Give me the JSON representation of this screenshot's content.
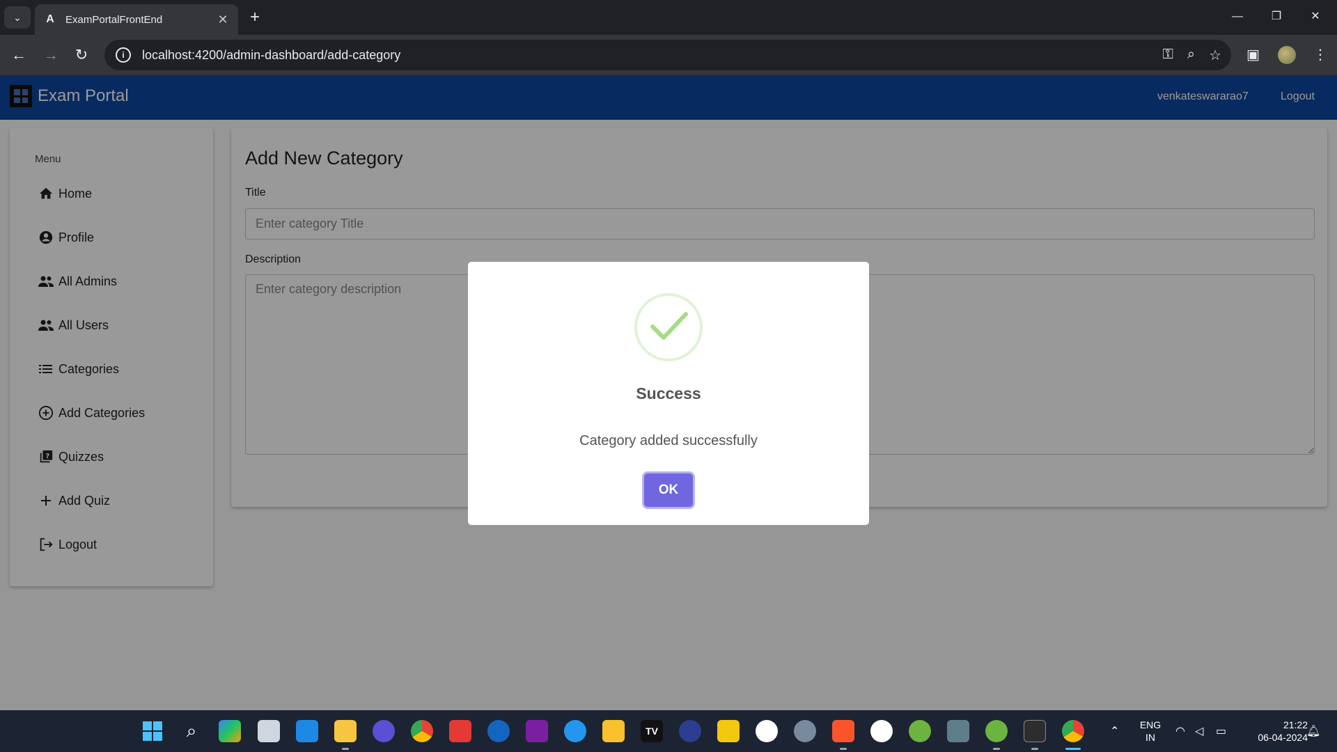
{
  "browser": {
    "tab_title": "ExamPortalFrontEnd",
    "tab_favicon": "A",
    "tab_close": "✕",
    "url": "localhost:4200/admin-dashboard/add-category"
  },
  "app": {
    "brand": "Exam Portal",
    "username": "venkateswararao7",
    "logout": "Logout"
  },
  "sidebar": {
    "heading": "Menu",
    "items": [
      {
        "label": "Home",
        "icon": "home-icon"
      },
      {
        "label": "Profile",
        "icon": "account-circle-icon"
      },
      {
        "label": "All Admins",
        "icon": "people-icon"
      },
      {
        "label": "All Users",
        "icon": "people-icon"
      },
      {
        "label": "Categories",
        "icon": "list-icon"
      },
      {
        "label": "Add Categories",
        "icon": "add-circle-icon"
      },
      {
        "label": "Quizzes",
        "icon": "quiz-icon"
      },
      {
        "label": "Add Quiz",
        "icon": "plus-icon"
      },
      {
        "label": "Logout",
        "icon": "logout-icon"
      }
    ]
  },
  "form": {
    "title": "Add New Category",
    "title_label": "Title",
    "title_placeholder": "Enter category Title",
    "description_label": "Description",
    "description_placeholder": "Enter category description"
  },
  "dialog": {
    "title": "Success",
    "message": "Category added successfully",
    "ok_label": "OK",
    "success_color": "#a5dc86",
    "button_color": "#7066e0"
  },
  "taskbar": {
    "language": "ENG",
    "region": "IN",
    "time": "21:22",
    "date": "06-04-2024"
  },
  "colors": {
    "header": "#0d47a1",
    "browser_frame": "#202124"
  }
}
